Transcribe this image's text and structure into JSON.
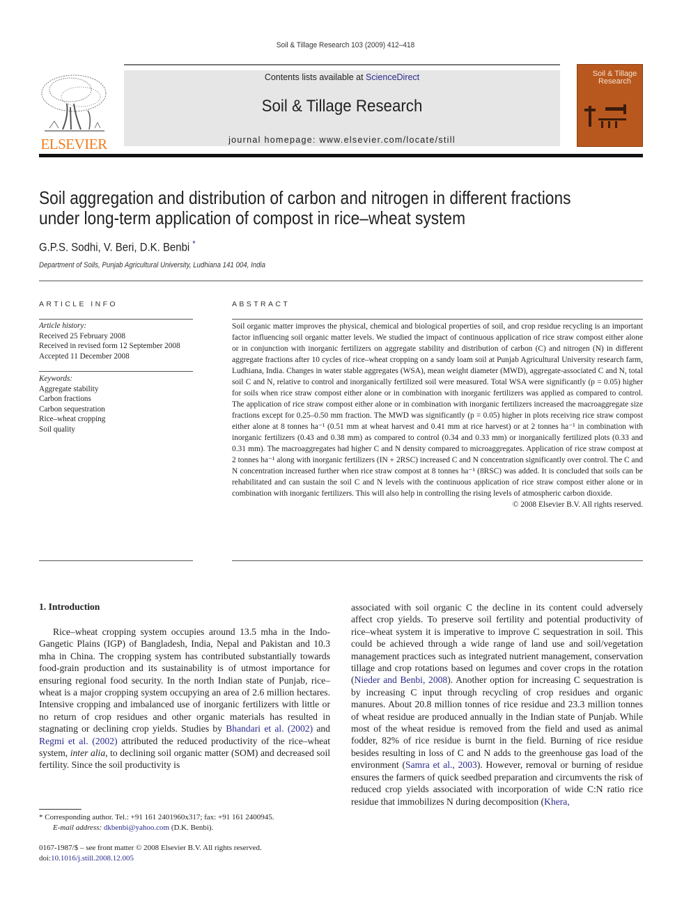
{
  "header": {
    "running_head": "Soil & Tillage Research 103 (2009) 412–418",
    "contents_prefix": "Contents lists available at ",
    "contents_link": "ScienceDirect",
    "journal_title": "Soil & Tillage Research",
    "homepage": "journal homepage: www.elsevier.com/locate/still",
    "publisher_logo_text": "ELSEVIER",
    "cover_title": "Soil & Tillage Research",
    "colors": {
      "publisher_orange": "#f07c1e",
      "cover_brown": "#b9581e",
      "link_blue": "#2a2a8c",
      "banner_gray": "#e6e6e6"
    }
  },
  "article": {
    "title_line1": "Soil aggregation and distribution of carbon and nitrogen in different fractions",
    "title_line2": "under long-term application of compost in rice–wheat system",
    "authors": "G.P.S. Sodhi, V. Beri, D.K. Benbi",
    "author_mark": "*",
    "affiliation": "Department of Soils, Punjab Agricultural University, Ludhiana 141 004, India"
  },
  "article_info": {
    "label": "ARTICLE INFO",
    "history_label": "Article history:",
    "history": [
      "Received 25 February 2008",
      "Received in revised form 12 September 2008",
      "Accepted 11 December 2008"
    ],
    "keywords_label": "Keywords:",
    "keywords": [
      "Aggregate stability",
      "Carbon fractions",
      "Carbon sequestration",
      "Rice–wheat cropping",
      "Soil quality"
    ]
  },
  "abstract": {
    "label": "ABSTRACT",
    "text": "Soil organic matter improves the physical, chemical and biological properties of soil, and crop residue recycling is an important factor influencing soil organic matter levels. We studied the impact of continuous application of rice straw compost either alone or in conjunction with inorganic fertilizers on aggregate stability and distribution of carbon (C) and nitrogen (N) in different aggregate fractions after 10 cycles of rice–wheat cropping on a sandy loam soil at Punjab Agricultural University research farm, Ludhiana, India. Changes in water stable aggregates (WSA), mean weight diameter (MWD), aggregate-associated C and N, total soil C and N, relative to control and inorganically fertilized soil were measured. Total WSA were significantly (p = 0.05) higher for soils when rice straw compost either alone or in combination with inorganic fertilizers was applied as compared to control. The application of rice straw compost either alone or in combination with inorganic fertilizers increased the macroaggregate size fractions except for 0.25–0.50 mm fraction. The MWD was significantly (p = 0.05) higher in plots receiving rice straw compost either alone at 8 tonnes ha⁻¹ (0.51 mm at wheat harvest and 0.41 mm at rice harvest) or at 2 tonnes ha⁻¹ in combination with inorganic fertilizers (0.43 and 0.38 mm) as compared to control (0.34 and 0.33 mm) or inorganically fertilized plots (0.33 and 0.31 mm). The macroaggregates had higher C and N density compared to microaggregates. Application of rice straw compost at 2 tonnes ha⁻¹ along with inorganic fertilizers (IN + 2RSC) increased C and N concentration significantly over control. The C and N concentration increased further when rice straw compost at 8 tonnes ha⁻¹ (8RSC) was added. It is concluded that soils can be rehabilitated and can sustain the soil C and N levels with the continuous application of rice straw compost either alone or in combination with inorganic fertilizers. This will also help in controlling the rising levels of atmospheric carbon dioxide.",
    "copyright": "© 2008 Elsevier B.V. All rights reserved."
  },
  "introduction": {
    "heading": "1.  Introduction",
    "left_col": {
      "p1": "Rice–wheat cropping system occupies around 13.5 mha in the Indo-Gangetic Plains (IGP) of Bangladesh, India, Nepal and Pakistan and 10.3 mha in China. The cropping system has contributed substantially towards food-grain production and its sustainability is of utmost importance for ensuring regional food security. In the north Indian state of Punjab, rice–wheat is a major cropping system occupying an area of 2.6 million hectares. Intensive cropping and imbalanced use of inorganic fertilizers with little or no return of crop residues and other organic materials has resulted in stagnating or declining crop yields. Studies by ",
      "ref1": "Bhandari et al. (2002)",
      "mid1": " and ",
      "ref2": "Regmi et al. (2002)",
      "mid2": " attributed the reduced productivity of the rice–wheat system, ",
      "italic": "inter alia",
      "end": ", to declining soil organic matter (SOM) and decreased soil fertility. Since the soil productivity is"
    },
    "right_col": {
      "t1": "associated with soil organic C the decline in its content could adversely affect crop yields. To preserve soil fertility and potential productivity of rice–wheat system it is imperative to improve C sequestration in soil. This could be achieved through a wide range of land use and soil/vegetation management practices such as integrated nutrient management, conservation tillage and crop rotations based on legumes and cover crops in the rotation (",
      "ref1": "Nieder and Benbi, 2008",
      "t2": "). Another option for increasing C sequestration is by increasing C input through recycling of crop residues and organic manures. About 20.8 million tonnes of rice residue and 23.3 million tonnes of wheat residue are produced annually in the Indian state of Punjab. While most of the wheat residue is removed from the field and used as animal fodder, 82% of rice residue is burnt in the field. Burning of rice residue besides resulting in loss of C and N adds to the greenhouse gas load of the environment (",
      "ref2": "Samra et al., 2003",
      "t3": "). However, removal or burning of residue ensures the farmers of quick seedbed preparation and circumvents the risk of reduced crop yields associated with incorporation of wide C:N ratio rice residue that immobilizes N during decomposition (",
      "ref3": "Khera,"
    }
  },
  "footnote": {
    "corresponding": "* Corresponding author. Tel.: +91 161 2401960x317; fax: +91 161 2400945.",
    "email_label": "E-mail address:",
    "email": "dkbenbi@yahoo.com",
    "email_suffix": " (D.K. Benbi).",
    "front_matter": "0167-1987/$ – see front matter © 2008 Elsevier B.V. All rights reserved.",
    "doi_prefix": "doi:",
    "doi": "10.1016/j.still.2008.12.005"
  }
}
